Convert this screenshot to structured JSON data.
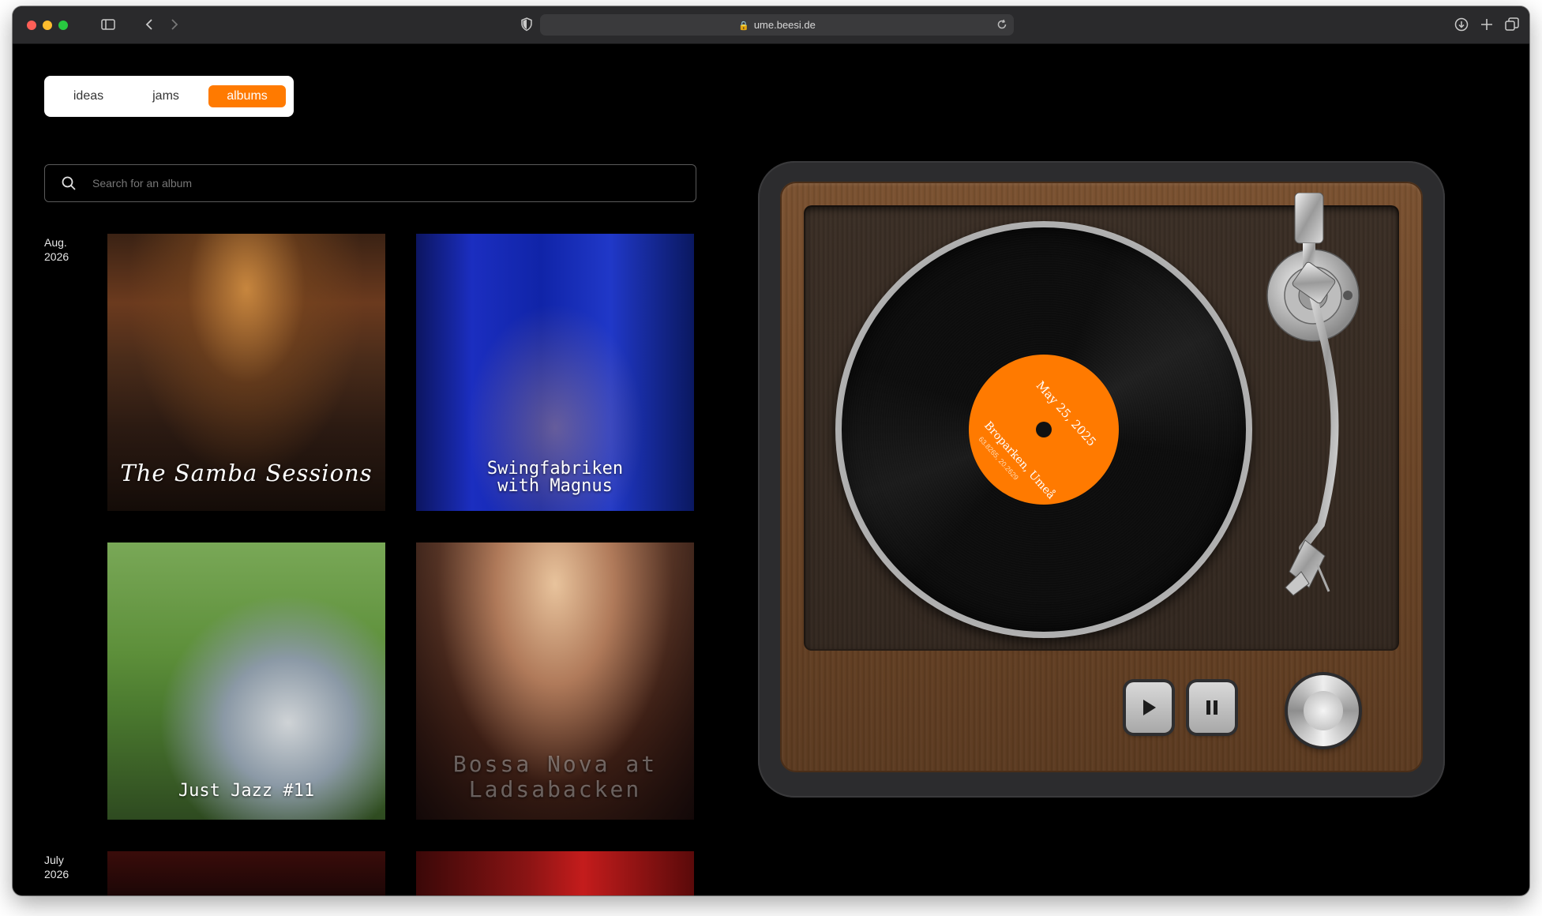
{
  "browser": {
    "url": "ume.beesi.de",
    "icons": [
      "sidebar-icon",
      "back-icon",
      "forward-icon",
      "shield-icon",
      "lock-icon",
      "reload-icon",
      "download-icon",
      "plus-icon",
      "tabs-icon"
    ]
  },
  "nav": {
    "tabs": [
      {
        "label": "ideas"
      },
      {
        "label": "jams"
      },
      {
        "label": "albums",
        "active": true
      }
    ],
    "accent_color": "#ff7a00"
  },
  "search": {
    "placeholder": "Search for an album",
    "value": ""
  },
  "timeline": [
    {
      "month": "Aug.",
      "year": "2026",
      "albums": [
        {
          "title": "The Samba Sessions"
        },
        {
          "title": "Swingfabriken with Magnus"
        },
        {
          "title": "Just Jazz #11"
        },
        {
          "title": "Bossa Nova at Ladsabacken"
        }
      ]
    },
    {
      "month": "July",
      "year": "2026",
      "albums": []
    }
  ],
  "player": {
    "record_label": {
      "date": "May 25, 2025",
      "place": "Broparken, Umeå",
      "coords": "63.8265, 20.2629"
    },
    "controls": {
      "play": "play-icon",
      "pause": "pause-icon",
      "knob": "volume-knob"
    }
  }
}
